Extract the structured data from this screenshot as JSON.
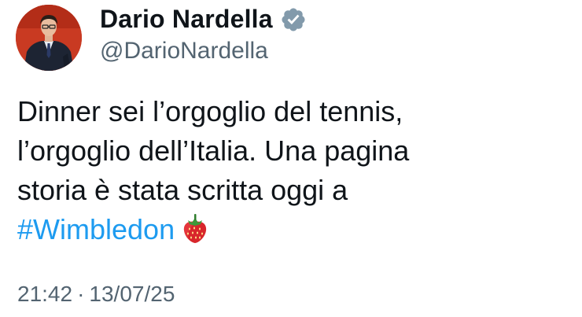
{
  "author": {
    "display_name": "Dario Nardella",
    "handle": "@DarioNardella",
    "avatar_icon": "profile-photo",
    "verified_icon": "verified-badge-icon",
    "verified_color": "#829aab"
  },
  "tweet": {
    "lines": [
      "Dinner sei l’orgoglio del tennis,",
      "l’orgoglio dell’Italia. Una pagina",
      "storia è stata scritta oggi a"
    ],
    "hashtag": "#Wimbledon",
    "hashtag_color": "#1d9bf0",
    "emoji_icon": "strawberry-icon"
  },
  "meta": {
    "time": "21:42",
    "separator": "·",
    "date": "13/07/25"
  }
}
